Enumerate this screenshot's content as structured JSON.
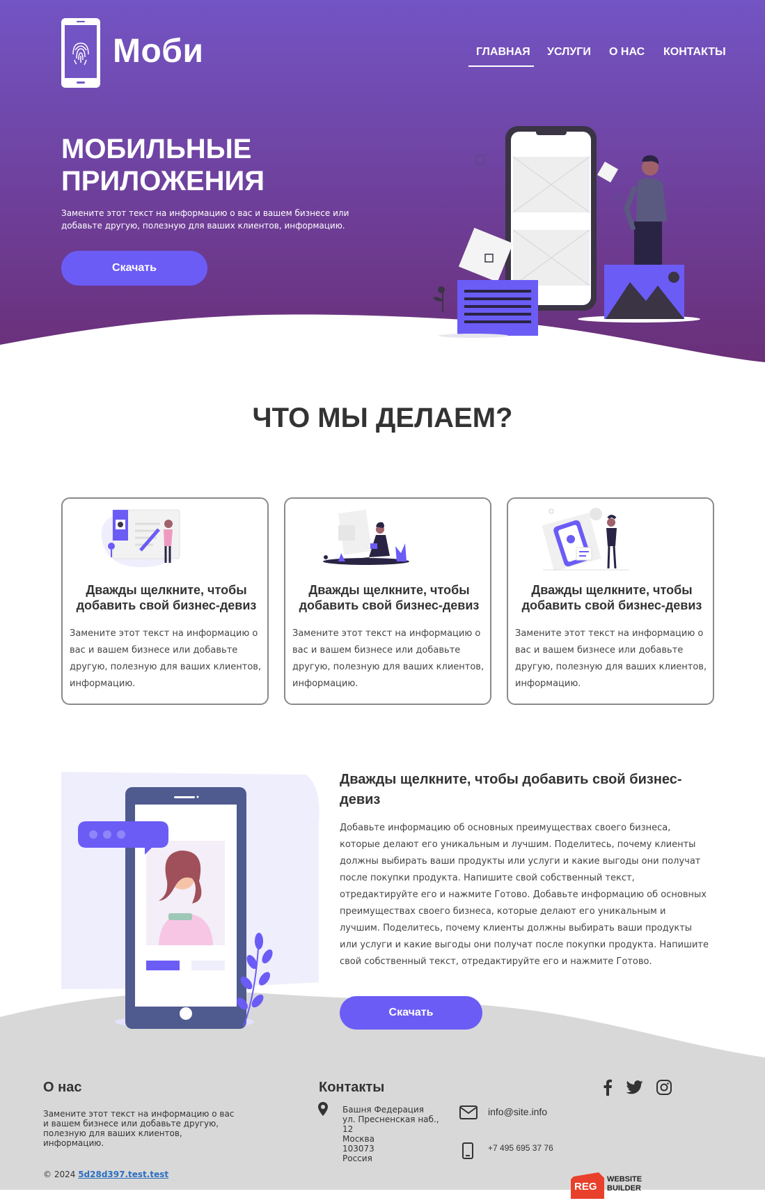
{
  "header": {
    "brand": "Моби",
    "nav": [
      "ГЛАВНАЯ",
      "УСЛУГИ",
      "О НАС",
      "КОНТАКТЫ"
    ],
    "active_nav": "ГЛАВНАЯ"
  },
  "hero": {
    "title_line1": "МОБИЛЬНЫЕ",
    "title_line2": "ПРИЛОЖЕНИЯ",
    "text": "Замените этот текст на информацию о вас и вашем бизнесе или добавьте другую, полезную для ваших клиентов, информацию.",
    "button": "Скачать"
  },
  "services": {
    "title": "ЧТО МЫ ДЕЛАЕМ?",
    "cards": [
      {
        "title": "Дважды щелкните, чтобы добавить свой бизнес-девиз",
        "text": "Замените этот текст на информацию о вас и вашем бизнесе или добавьте другую, полезную для ваших клиентов, информацию."
      },
      {
        "title": "Дважды щелкните, чтобы добавить свой бизнес-девиз",
        "text": "Замените этот текст на информацию о вас и вашем бизнесе или добавьте другую, полезную для ваших клиентов, информацию."
      },
      {
        "title": "Дважды щелкните, чтобы добавить свой бизнес-девиз",
        "text": "Замените этот текст на информацию о вас и вашем бизнесе или добавьте другую, полезную для ваших клиентов, информацию."
      }
    ]
  },
  "feature": {
    "title": "Дважды щелкните, чтобы добавить свой бизнес-девиз",
    "text": "Добавьте информацию об основных преимуществах своего бизнеса, которые делают его уникальным и лучшим. Поделитесь, почему клиенты должны выбирать ваши продукты или услуги и какие выгоды они получат после покупки продукта. Напишите свой собственный текст, отредактируйте его и нажмите Готово. Добавьте информацию об основных преимуществах своего бизнеса, которые делают его уникальным и лучшим. Поделитесь, почему клиенты должны выбирать ваши продукты или услуги и какие выгоды они получат после покупки продукта. Напишите свой собственный текст, отредактируйте его и нажмите Готово.",
    "button": "Скачать"
  },
  "footer": {
    "about_title": "О нас",
    "about_text": "Замените этот текст на информацию о вас и вашем бизнесе или добавьте другую, полезную для ваших клиентов, информацию.",
    "contacts_title": "Контакты",
    "address": [
      "Башня Федерация",
      "ул. Пресненская наб.,",
      "12",
      "Москва",
      "103073",
      "Россия"
    ],
    "email": "info@site.info",
    "phone": "+7 495 695 37 76",
    "copyright": "© 2024",
    "site_link": "5d28d397.test.test",
    "reg_badge": "REG",
    "builder_line1": "WEBSITE",
    "builder_line2": "BUILDER"
  },
  "icons": [
    "fingerprint-phone-icon",
    "facebook-icon",
    "twitter-icon",
    "instagram-icon",
    "location-pin-icon",
    "envelope-icon",
    "mobile-phone-icon"
  ],
  "colors": {
    "hero_top": "#7354c4",
    "hero_bottom": "#6a2f78",
    "accent": "#6b5cf6",
    "footer_bg": "#d8d8d8",
    "text": "#333333"
  }
}
